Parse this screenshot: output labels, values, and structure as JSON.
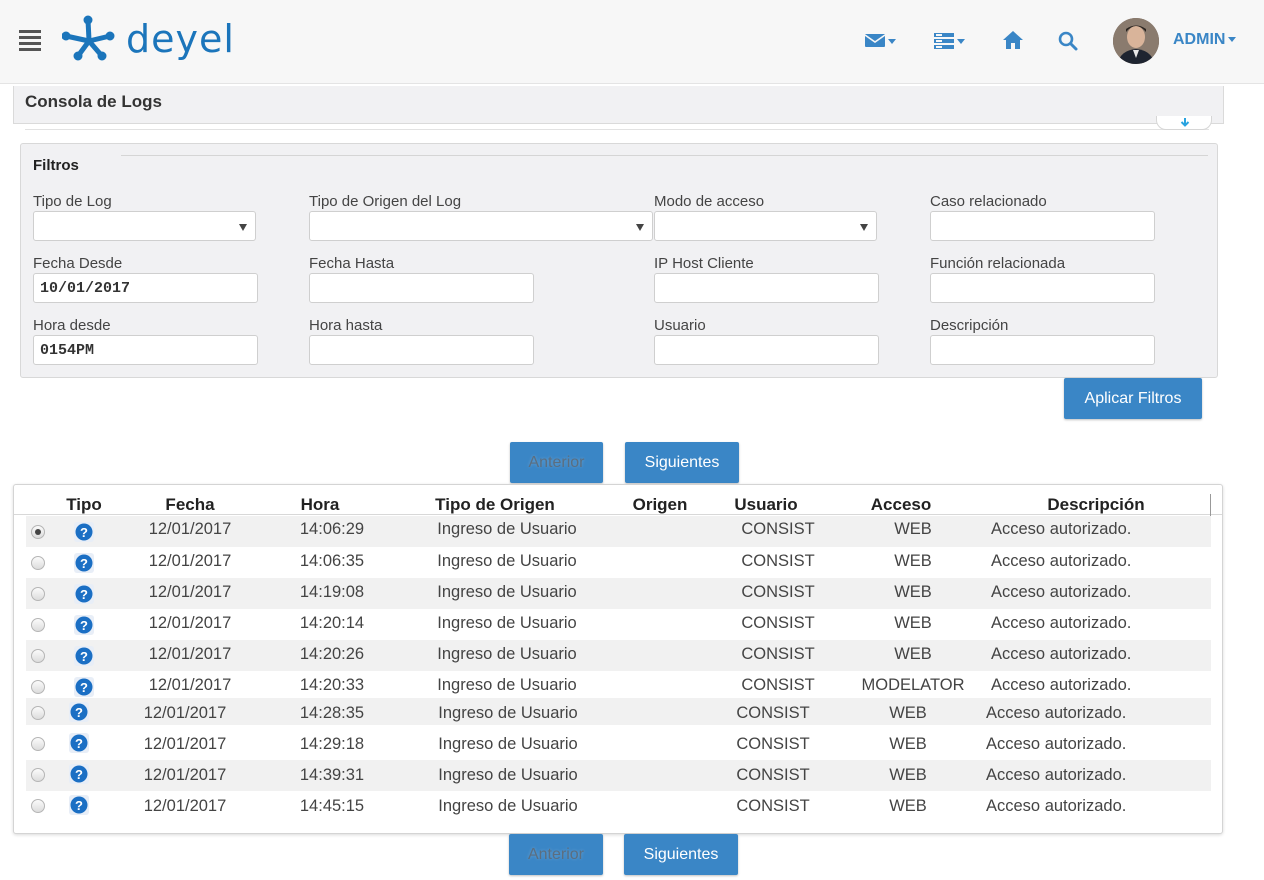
{
  "brand": {
    "name": "deyel",
    "color": "#1b75bb",
    "accent": "#3a86c6"
  },
  "topbar": {
    "icons": [
      "menu-icon",
      "mail-icon",
      "tasks-icon",
      "home-icon",
      "search-icon"
    ],
    "user": "ADMIN"
  },
  "page": {
    "title": "Consola de Logs"
  },
  "filters": {
    "legend": "Filtros",
    "tipo_log": {
      "label": "Tipo de Log",
      "value": ""
    },
    "tipo_origen": {
      "label": "Tipo de Origen del Log",
      "value": ""
    },
    "modo_acceso": {
      "label": "Modo de acceso",
      "value": ""
    },
    "caso": {
      "label": "Caso relacionado",
      "value": ""
    },
    "fecha_desde": {
      "label": "Fecha Desde",
      "value": "10/01/2017"
    },
    "fecha_hasta": {
      "label": "Fecha Hasta",
      "value": ""
    },
    "ip_host": {
      "label": "IP Host Cliente",
      "value": ""
    },
    "funcion": {
      "label": "Función relacionada",
      "value": ""
    },
    "hora_desde": {
      "label": "Hora desde",
      "value": "0154PM"
    },
    "hora_hasta": {
      "label": "Hora hasta",
      "value": ""
    },
    "usuario": {
      "label": "Usuario",
      "value": ""
    },
    "descripcion": {
      "label": "Descripción",
      "value": ""
    },
    "apply_label": "Aplicar Filtros"
  },
  "pager": {
    "prev_label": "Anterior",
    "next_label": "Siguientes"
  },
  "grid": {
    "columns": {
      "tipo": "Tipo",
      "fecha": "Fecha",
      "hora": "Hora",
      "tipo_origen": "Tipo de Origen",
      "origen": "Origen",
      "usuario": "Usuario",
      "acceso": "Acceso",
      "descripcion": "Descripción"
    },
    "rows": [
      {
        "fecha": "12/01/2017",
        "hora": "14:06:29",
        "tipo_origen": "Ingreso de Usuario",
        "usuario": "CONSIST",
        "acceso": "WEB",
        "descripcion": "Acceso autorizado.",
        "selected": true
      },
      {
        "fecha": "12/01/2017",
        "hora": "14:06:35",
        "tipo_origen": "Ingreso de Usuario",
        "usuario": "CONSIST",
        "acceso": "WEB",
        "descripcion": "Acceso autorizado.",
        "selected": false
      },
      {
        "fecha": "12/01/2017",
        "hora": "14:19:08",
        "tipo_origen": "Ingreso de Usuario",
        "usuario": "CONSIST",
        "acceso": "WEB",
        "descripcion": "Acceso autorizado.",
        "selected": false
      },
      {
        "fecha": "12/01/2017",
        "hora": "14:20:14",
        "tipo_origen": "Ingreso de Usuario",
        "usuario": "CONSIST",
        "acceso": "WEB",
        "descripcion": "Acceso autorizado.",
        "selected": false
      },
      {
        "fecha": "12/01/2017",
        "hora": "14:20:26",
        "tipo_origen": "Ingreso de Usuario",
        "usuario": "CONSIST",
        "acceso": "WEB",
        "descripcion": "Acceso autorizado.",
        "selected": false
      },
      {
        "fecha": "12/01/2017",
        "hora": "14:20:33",
        "tipo_origen": "Ingreso de Usuario",
        "usuario": "CONSIST",
        "acceso": "MODELATOR",
        "descripcion": "Acceso autorizado.",
        "selected": false
      },
      {
        "fecha": "12/01/2017",
        "hora": "14:28:35",
        "tipo_origen": "Ingreso de Usuario",
        "usuario": "CONSIST",
        "acceso": "WEB",
        "descripcion": "Acceso autorizado.",
        "selected": false
      },
      {
        "fecha": "12/01/2017",
        "hora": "14:29:18",
        "tipo_origen": "Ingreso de Usuario",
        "usuario": "CONSIST",
        "acceso": "WEB",
        "descripcion": "Acceso autorizado.",
        "selected": false
      },
      {
        "fecha": "12/01/2017",
        "hora": "14:39:31",
        "tipo_origen": "Ingreso de Usuario",
        "usuario": "CONSIST",
        "acceso": "WEB",
        "descripcion": "Acceso autorizado.",
        "selected": false
      },
      {
        "fecha": "12/01/2017",
        "hora": "14:45:15",
        "tipo_origen": "Ingreso de Usuario",
        "usuario": "CONSIST",
        "acceso": "WEB",
        "descripcion": "Acceso autorizado.",
        "selected": false
      }
    ]
  }
}
